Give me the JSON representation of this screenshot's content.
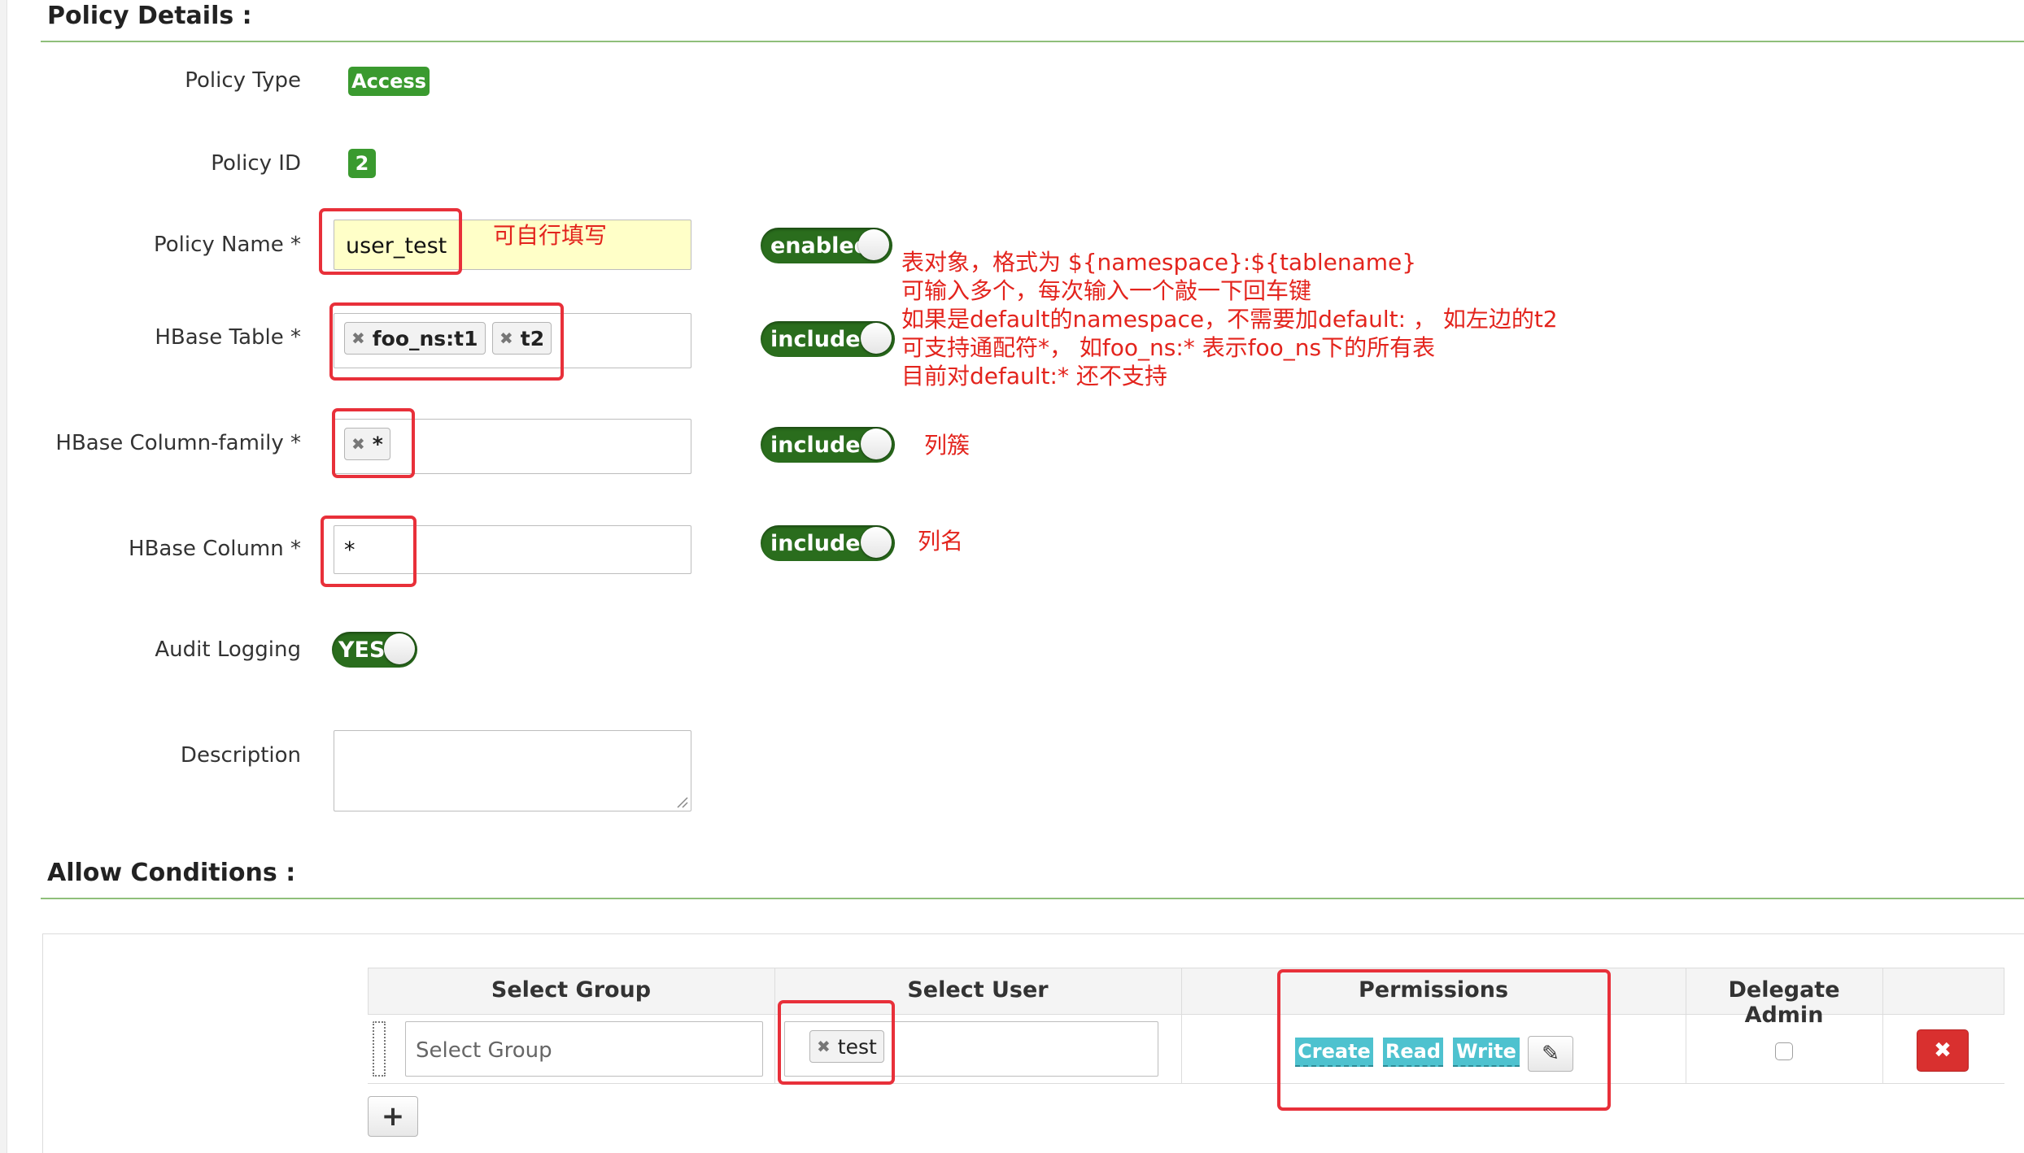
{
  "policy_details": {
    "title": "Policy Details :",
    "policy_type_label": "Policy Type",
    "policy_type_value": "Access",
    "policy_id_label": "Policy ID",
    "policy_id_value": "2",
    "policy_name_label": "Policy Name *",
    "policy_name_value": "user_test",
    "policy_name_note": "可自行填写",
    "policy_enabled_label": "enabled",
    "hbase_table_label": "HBase Table *",
    "hbase_table_tags": [
      "foo_ns:t1",
      "t2"
    ],
    "hbase_table_toggle": "include",
    "hbase_table_notes": [
      "表对象，格式为 ${namespace}:${tablename}",
      "可输入多个，每次输入一个敲一下回车键",
      "如果是default的namespace，不需要加default: ，  如左边的t2",
      "可支持通配符*，  如foo_ns:* 表示foo_ns下的所有表",
      "目前对default:* 还不支持"
    ],
    "column_family_label": "HBase Column-family *",
    "column_family_tags": [
      "*"
    ],
    "column_family_toggle": "include",
    "column_family_note": "列簇",
    "column_label": "HBase Column *",
    "column_value": "*",
    "column_toggle": "include",
    "column_note": "列名",
    "audit_logging_label": "Audit Logging",
    "audit_logging_value": "YES",
    "description_label": "Description",
    "description_value": ""
  },
  "allow_conditions": {
    "title": "Allow Conditions :",
    "columns": [
      "Select Group",
      "Select User",
      "Permissions",
      "Delegate Admin"
    ],
    "rows": [
      {
        "group_placeholder": "Select Group",
        "user_tags": [
          "test"
        ],
        "permissions": [
          "Create",
          "Read",
          "Write"
        ],
        "delegate_admin": false,
        "delete_label": "✖"
      }
    ],
    "add_label": "+"
  },
  "colors": {
    "green_badge": "#3a9a2f",
    "toggle_on": "#2a6d1d",
    "annotation_red": "#e3241d",
    "permission_tag": "#4ec2cf",
    "delete_button": "#d9302f"
  },
  "icons": {
    "tag_remove": "remove-x-icon",
    "edit_permissions": "pencil-icon",
    "drag_handle": "drag-handle-icon",
    "delete_row": "delete-x-icon",
    "add_row": "plus-icon"
  }
}
